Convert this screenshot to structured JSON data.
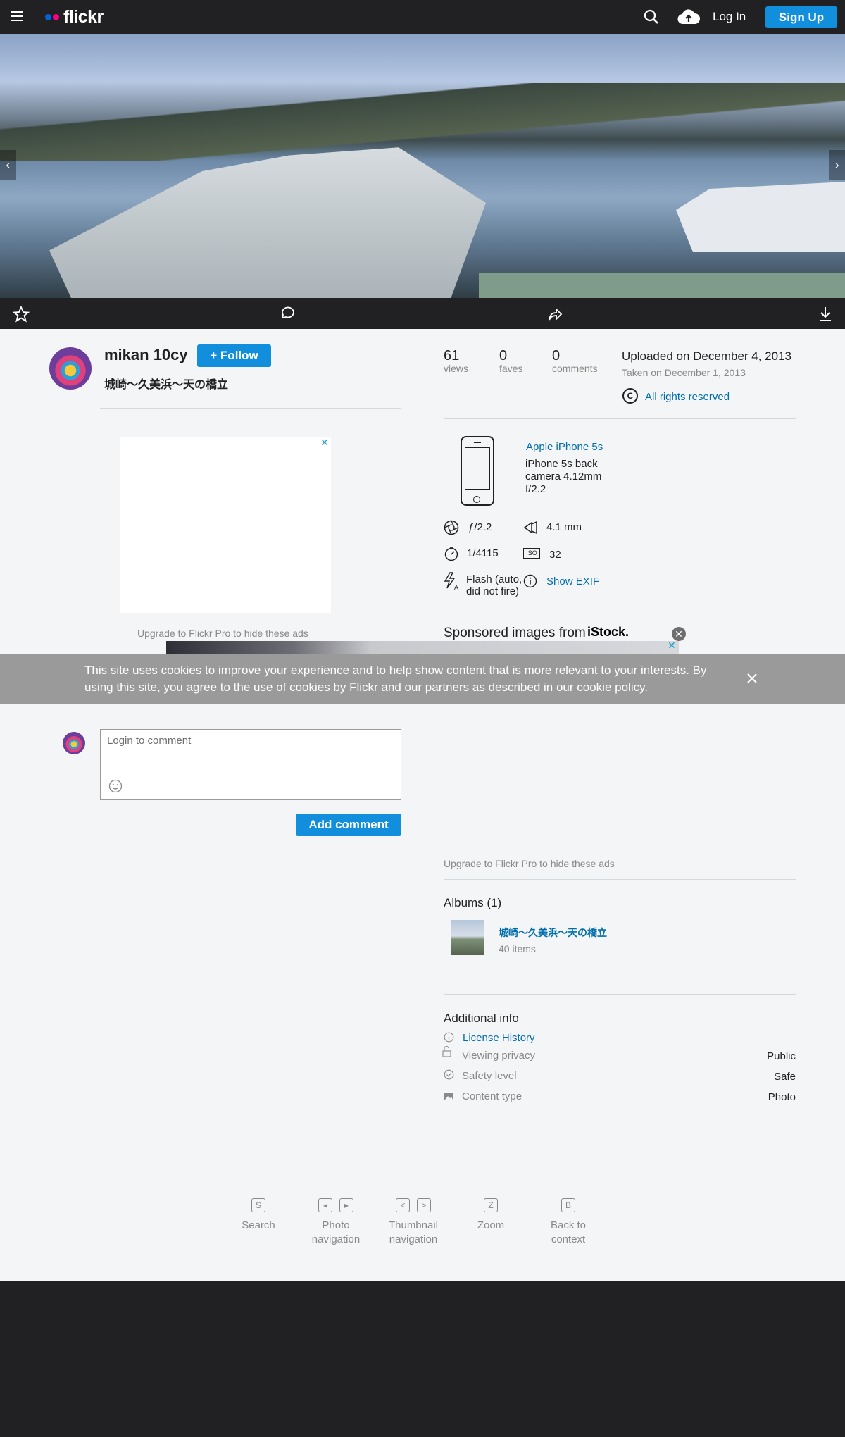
{
  "nav": {
    "logo_text": "flickr",
    "login_label": "Log In",
    "signup_label": "Sign Up",
    "brand_colors": {
      "blue": "#0063dc",
      "pink": "#ff0084"
    }
  },
  "photo": {
    "prev_glyph": "‹",
    "next_glyph": "›"
  },
  "owner": {
    "name": "mikan 10cy",
    "follow_label": "Follow",
    "follow_glyph": "+",
    "photo_title": "城崎〜久美浜〜天の橋立"
  },
  "ads": {
    "close_glyph": "✕",
    "upgrade_left": "Upgrade to Flickr Pro to hide these ads",
    "upgrade_right": "Upgrade to Flickr Pro to hide these ads",
    "sponsored_label": "Sponsored images from",
    "sponsor_brand": "iStock."
  },
  "stats": [
    {
      "value": "61",
      "label": "views"
    },
    {
      "value": "0",
      "label": "faves"
    },
    {
      "value": "0",
      "label": "comments"
    }
  ],
  "meta": {
    "uploaded": "Uploaded on December 4, 2013",
    "taken": "Taken on December 1, 2013",
    "rights_symbol": "C",
    "rights": "All rights reserved"
  },
  "camera": {
    "make": "Apple iPhone 5s",
    "lens": "iPhone 5s back camera 4.12mm f/2.2",
    "aperture": "ƒ/2.2",
    "focal_length": "4.1 mm",
    "exposure": "1/4115",
    "iso_badge": "ISO",
    "iso": "32",
    "flash": "Flash (auto, did not fire)",
    "show_exif": "Show EXIF"
  },
  "cookie": {
    "text": "This site uses cookies to improve your experience and to help show content that is more relevant to your interests. By using this site, you agree to the use of cookies by Flickr and our partners as described in our ",
    "link": "cookie policy",
    "after": "."
  },
  "comment": {
    "placeholder": "Login to comment",
    "add_label": "Add comment"
  },
  "albums": {
    "title": "Albums (1)",
    "items": [
      {
        "name": "城崎〜久美浜〜天の橋立",
        "count": "40 items"
      }
    ]
  },
  "additional": {
    "title": "Additional info",
    "license_history": "License History",
    "rows": [
      {
        "label": "Viewing privacy",
        "value": "Public"
      },
      {
        "label": "Safety level",
        "value": "Safe"
      },
      {
        "label": "Content type",
        "value": "Photo"
      }
    ]
  },
  "shortcuts": [
    {
      "keys": [
        "S"
      ],
      "label": "Search"
    },
    {
      "keys": [
        "◂",
        "▸"
      ],
      "label": "Photo navigation"
    },
    {
      "keys": [
        "<",
        ">"
      ],
      "label": "Thumbnail navigation"
    },
    {
      "keys": [
        "Z"
      ],
      "label": "Zoom"
    },
    {
      "keys": [
        "B"
      ],
      "label": "Back to context"
    }
  ]
}
